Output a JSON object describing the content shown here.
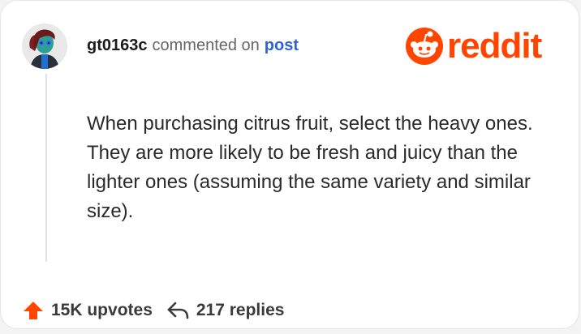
{
  "comment": {
    "username": "gt0163c",
    "action_text": "commented on",
    "post_link_label": "post",
    "body": "When purchasing citrus fruit, select the heavy ones. They are more likely to be fresh and juicy than the lighter ones (assuming the same variety and similar size)."
  },
  "branding": {
    "logo_text": "reddit",
    "brand_color": "#ff4500"
  },
  "stats": {
    "upvotes_label": "15K upvotes",
    "replies_label": "217 replies"
  },
  "icons": {
    "upvote": "upvote-arrow-icon",
    "reply": "reply-arrow-icon",
    "logo": "reddit-snoo-icon"
  },
  "colors": {
    "link": "#2e63d6",
    "upvote": "#ff4500",
    "text": "#2a2a2a",
    "muted": "#666666"
  }
}
